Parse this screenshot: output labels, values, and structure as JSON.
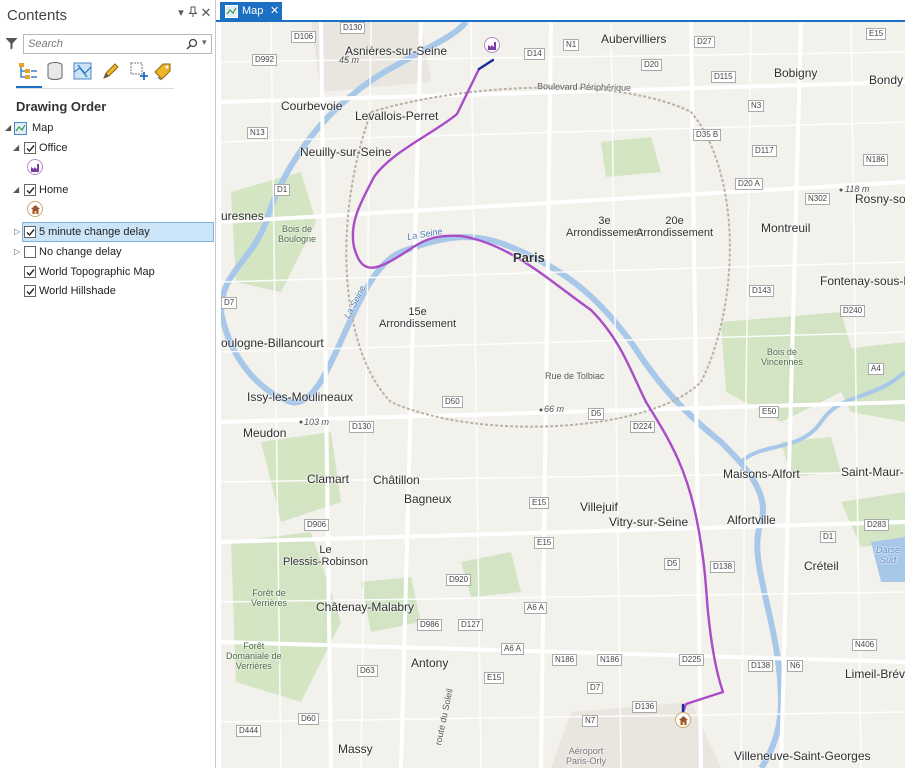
{
  "pane": {
    "title": "Contents",
    "search_placeholder": "Search",
    "section_title": "Drawing Order",
    "layers": [
      {
        "label": "Map",
        "checked": null
      },
      {
        "label": "Office",
        "checked": true
      },
      {
        "label": "Home",
        "checked": true
      },
      {
        "label": "5 minute change delay",
        "checked": true,
        "selected": true
      },
      {
        "label": "No change delay",
        "checked": false
      },
      {
        "label": "World Topographic Map",
        "checked": true
      },
      {
        "label": "World Hillshade",
        "checked": true
      }
    ]
  },
  "tab": {
    "label": "Map"
  },
  "map": {
    "places": {
      "asnieres": "Asnières-sur-Seine",
      "aubervilliers": "Aubervilliers",
      "bobigny": "Bobigny",
      "bondy": "Bondy",
      "courbevoie": "Courbevoie",
      "levallois": "Levallois-Perret",
      "neuilly": "Neuilly-sur-Seine",
      "suresnes": "uresnes",
      "paris": "Paris",
      "arr3": "3e\nArrondissement",
      "arr20": "20e\nArrondissement",
      "montreuil": "Montreuil",
      "rosny": "Rosny-sou",
      "fontenay": "Fontenay-sous-B",
      "arr15": "15e\nArrondissement",
      "boulogne": "oulogne-Billancourt",
      "issy": "Issy-les-Moulineaux",
      "meudon": "Meudon",
      "clamart": "Clamart",
      "chatillon": "Châtillon",
      "bagneux": "Bagneux",
      "villejuif": "Villejuif",
      "vitry": "Vitry-sur-Seine",
      "maisons": "Maisons-Alfort",
      "alfortville": "Alfortville",
      "saintmaur": "Saint-Maur-",
      "creteil": "Créteil",
      "plessis": "Le\nPlessis-Robinson",
      "chatenay": "Châtenay-Malabry",
      "antony": "Antony",
      "massy": "Massy",
      "limeil": "Limeil-Brév",
      "villeneuve": "Villeneuve-Saint-Georges"
    },
    "features": {
      "bois_boulogne": "Bois de\nBoulogne",
      "bois_vincennes": "Bois de\nVincennes",
      "foret_verrieres": "Forêt de\nVerrières",
      "foret_dom_verrieres": "Forêt\nDomaniale de\nVerrières",
      "darse_sud": "Darse\nSud",
      "aeroport": "Aéroport\nParis-Orly",
      "la_seine_1": "La Seine",
      "la_seine_2": "La Seine"
    },
    "streets": {
      "peripherique": "Boulevard Périphérique",
      "tolbiac": "Rue de Tolbiac",
      "route_soleil": "route du Soleil"
    },
    "elevations": {
      "e1": "45 m",
      "e2": "118 m",
      "e3": "66 m",
      "e4": "103 m"
    },
    "road_shields": [
      "D130",
      "D106",
      "D992",
      "D14",
      "N1",
      "D27",
      "E15",
      "D20",
      "D115",
      "N13",
      "N3",
      "D35 B",
      "D117",
      "N186",
      "D1",
      "D20 A",
      "N302",
      "D7",
      "D143",
      "D240",
      "D50",
      "D5",
      "D224",
      "D130",
      "A4",
      "E50",
      "E15",
      "D906",
      "E15",
      "D920",
      "D5",
      "D138",
      "D283",
      "D1",
      "D986",
      "D127",
      "A6 A",
      "A6 A",
      "N186",
      "N186",
      "N406",
      "D63",
      "D225",
      "D138",
      "N6",
      "E15",
      "D7",
      "D60",
      "D136",
      "N7",
      "D444",
      "N186"
    ],
    "route_color": "#a94cc7",
    "route_end_color": "#1a2a9c"
  }
}
